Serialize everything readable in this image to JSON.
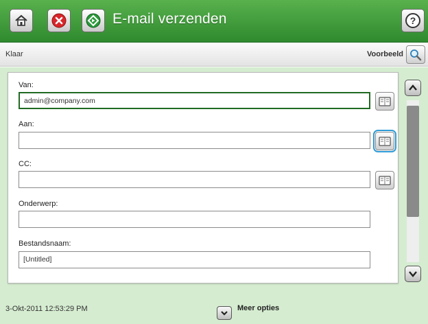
{
  "titlebar": {
    "title": "E-mail verzenden",
    "icons": {
      "home": "home-icon",
      "stop": "stop-icon",
      "start": "start-icon",
      "help": "help-icon"
    }
  },
  "status": {
    "text": "Klaar",
    "preview_label": "Voorbeeld",
    "preview_icon": "magnifier-icon"
  },
  "form": {
    "fields": [
      {
        "label": "Van:",
        "value": "admin@company.com",
        "address_book": true
      },
      {
        "label": "Aan:",
        "value": "",
        "address_book": true
      },
      {
        "label": "CC:",
        "value": "",
        "address_book": true
      },
      {
        "label": "Onderwerp:",
        "value": "",
        "address_book": false
      },
      {
        "label": "Bestandsnaam:",
        "value": "[Untitled]",
        "address_book": false
      }
    ]
  },
  "footer": {
    "datetime": "3-Okt-2011 12:53:29 PM",
    "more_label": "Meer opties"
  },
  "colors": {
    "titlebar": "#3a9a38",
    "background": "#d5ecd0",
    "active_border": "#1f6a22",
    "highlight": "#2e9bd6",
    "stop_red": "#d9262b",
    "start_green": "#2a9a3b"
  }
}
